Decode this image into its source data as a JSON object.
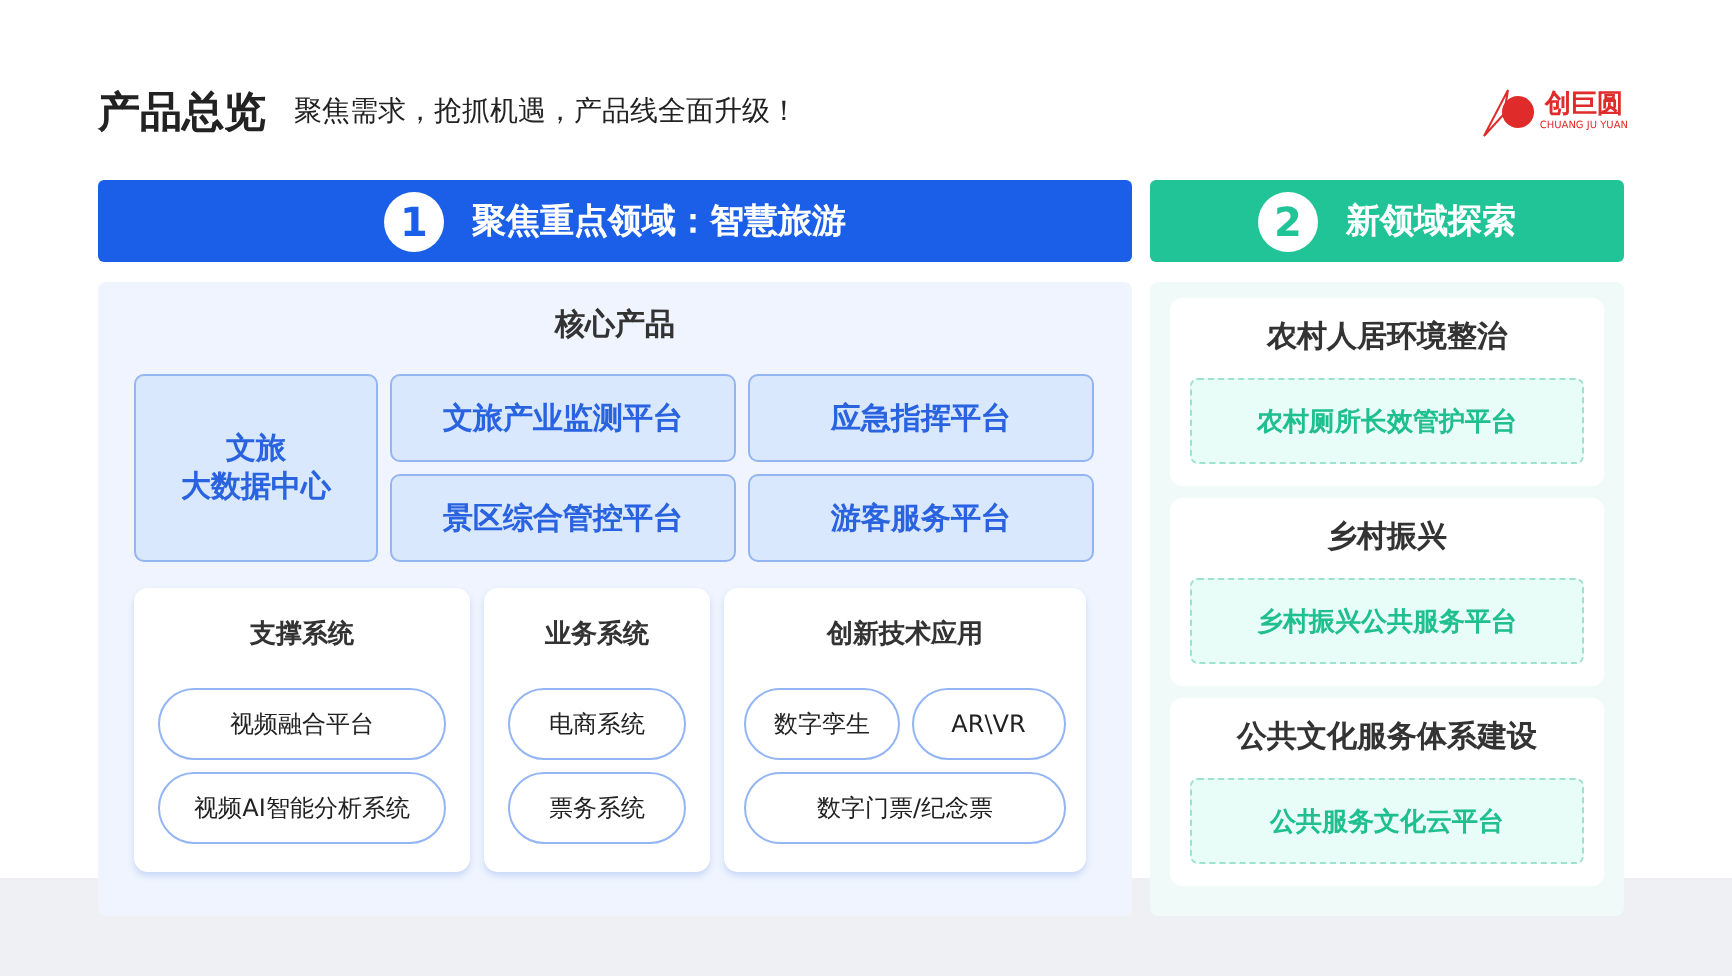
{
  "header": {
    "title": "产品总览",
    "subtitle": "聚焦需求，抢抓机遇，产品线全面升级！",
    "logo": {
      "name": "创巨圆",
      "tagline": "CHUANG JU YUAN"
    }
  },
  "sections": [
    {
      "number": "1",
      "title": "聚焦重点领域：智慧旅游",
      "color": "#1b5ee8"
    },
    {
      "number": "2",
      "title": "新领域探索",
      "color": "#20c497"
    }
  ],
  "core": {
    "title": "核心产品",
    "center_lines": [
      "文旅",
      "大数据中心"
    ],
    "platforms": [
      "文旅产业监测平台",
      "应急指挥平台",
      "景区综合管控平台",
      "游客服务平台"
    ]
  },
  "systems": [
    {
      "title": "支撑系统",
      "kind": "list",
      "items": [
        "视频融合平台",
        "视频AI智能分析系统"
      ]
    },
    {
      "title": "业务系统",
      "kind": "list",
      "items": [
        "电商系统",
        "票务系统"
      ]
    },
    {
      "title": "创新技术应用",
      "kind": "grid",
      "items": [
        "数字孪生",
        "AR\\VR",
        "数字门票/纪念票"
      ]
    }
  ],
  "areas": [
    {
      "title": "农村人居环境整治",
      "platform": "农村厕所长效管护平台"
    },
    {
      "title": "乡村振兴",
      "platform": "乡村振兴公共服务平台"
    },
    {
      "title": "公共文化服务体系建设",
      "platform": "公共服务文化云平台"
    }
  ]
}
